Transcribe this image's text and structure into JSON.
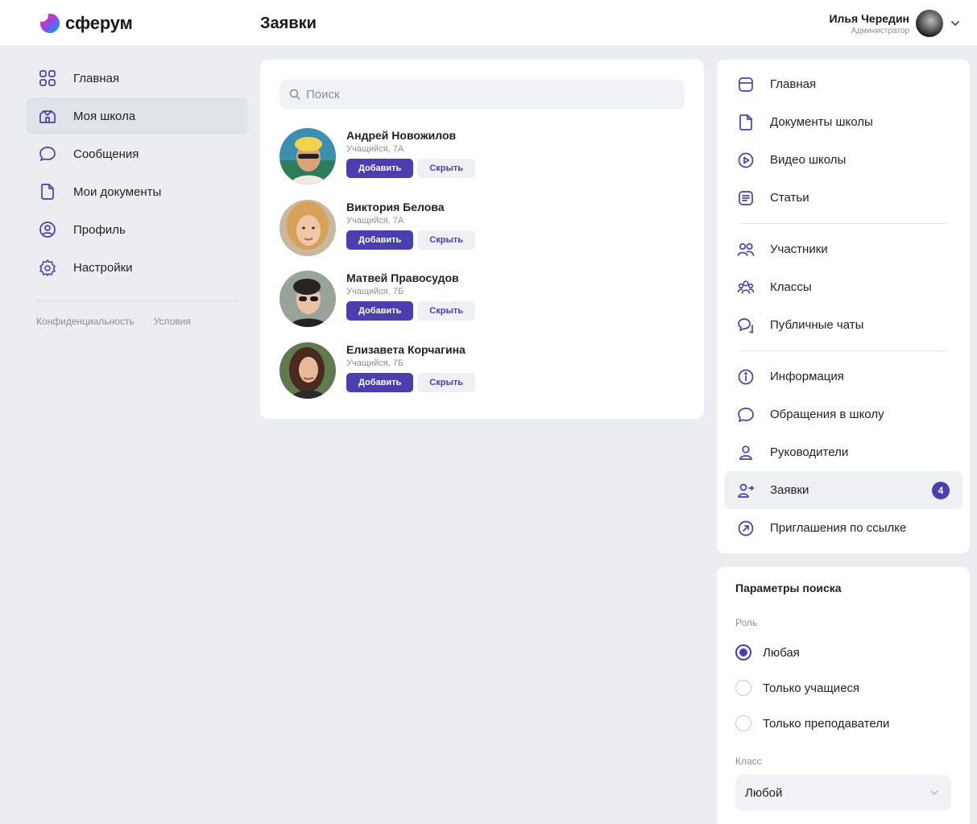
{
  "header": {
    "logo_text": "сферум",
    "page_title": "Заявки",
    "user_name": "Илья Чередин",
    "user_role": "Администратор"
  },
  "left_nav": {
    "items": [
      {
        "label": "Главная",
        "icon": "grid-icon"
      },
      {
        "label": "Моя школа",
        "icon": "school-icon",
        "active": true
      },
      {
        "label": "Сообщения",
        "icon": "message-icon"
      },
      {
        "label": "Мои документы",
        "icon": "document-icon"
      },
      {
        "label": "Профиль",
        "icon": "profile-icon"
      },
      {
        "label": "Настройки",
        "icon": "gear-icon"
      }
    ],
    "footer": {
      "privacy": "Конфиденциальность",
      "terms": "Условия"
    }
  },
  "search": {
    "placeholder": "Поиск"
  },
  "requests": [
    {
      "name": "Андрей Новожилов",
      "role": "Учащийся, 7А",
      "add": "Добавить",
      "hide": "Скрыть"
    },
    {
      "name": "Виктория Белова",
      "role": "Учащийся, 7А",
      "add": "Добавить",
      "hide": "Скрыть"
    },
    {
      "name": "Матвей Правосудов",
      "role": "Учащийся, 7Б",
      "add": "Добавить",
      "hide": "Скрыть"
    },
    {
      "name": "Елизавета Корчагина",
      "role": "Учащийся, 7Б",
      "add": "Добавить",
      "hide": "Скрыть"
    }
  ],
  "school_menu": {
    "group1": [
      {
        "label": "Главная",
        "icon": "home-card-icon"
      },
      {
        "label": "Документы школы",
        "icon": "document-icon"
      },
      {
        "label": "Видео школы",
        "icon": "play-icon"
      },
      {
        "label": "Статьи",
        "icon": "article-icon"
      }
    ],
    "group2": [
      {
        "label": "Участники",
        "icon": "people-icon"
      },
      {
        "label": "Классы",
        "icon": "classes-icon"
      },
      {
        "label": "Публичные чаты",
        "icon": "chats-icon"
      }
    ],
    "group3": [
      {
        "label": "Информация",
        "icon": "info-icon"
      },
      {
        "label": "Обращения в школу",
        "icon": "message-icon"
      },
      {
        "label": "Руководители",
        "icon": "person-icon"
      },
      {
        "label": "Заявки",
        "icon": "person-arrow-icon",
        "active": true,
        "badge": "4"
      },
      {
        "label": "Приглашения по ссылке",
        "icon": "link-arrow-icon"
      }
    ]
  },
  "filters": {
    "title": "Параметры поиска",
    "role_label": "Роль",
    "role_options": [
      {
        "label": "Любая",
        "checked": true
      },
      {
        "label": "Только учащиеся",
        "checked": false
      },
      {
        "label": "Только преподаватели",
        "checked": false
      }
    ],
    "class_label": "Класс",
    "class_value": "Любой"
  },
  "colors": {
    "accent": "#4b3fb0",
    "background": "#ebedf0"
  }
}
